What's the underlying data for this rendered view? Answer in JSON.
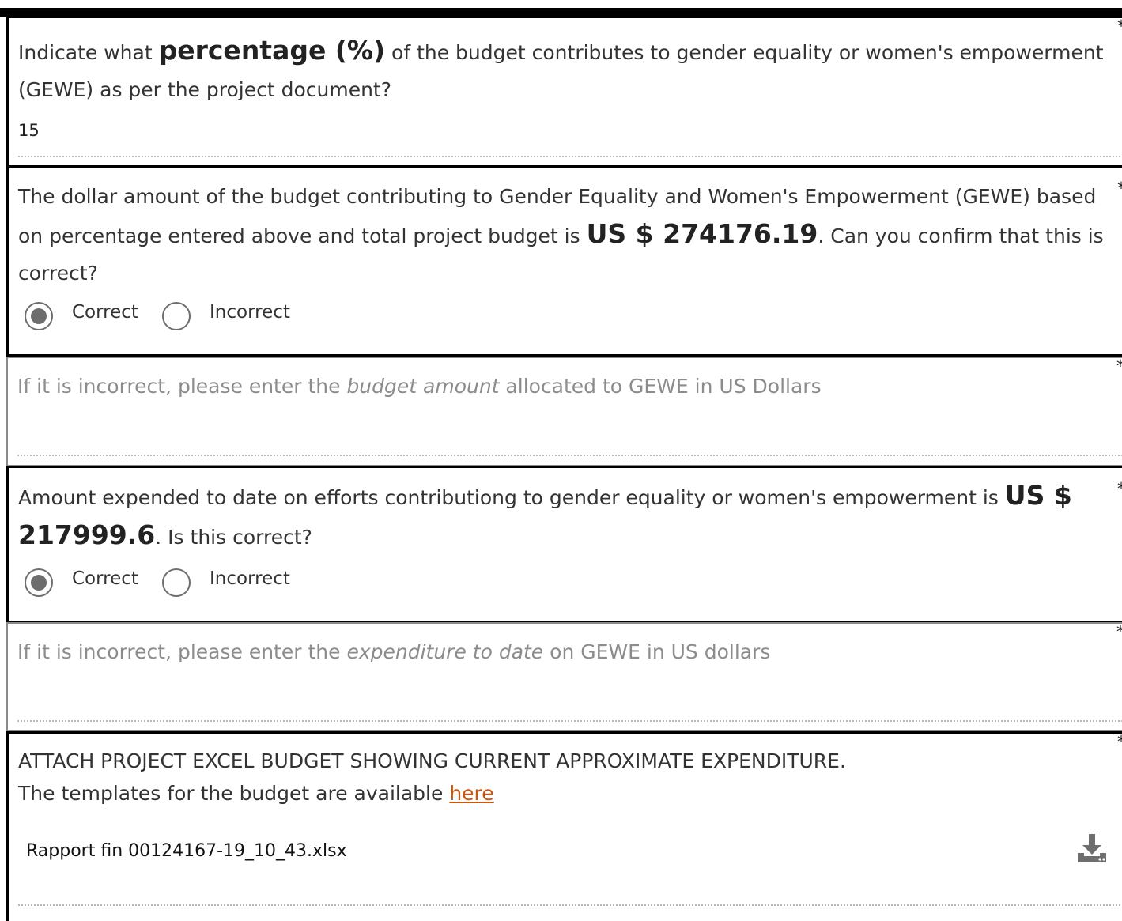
{
  "q1": {
    "text_a": "Indicate what ",
    "text_bold": "percentage (%)",
    "text_b": " of the budget contributes to gender equality or women's empowerment (GEWE) as per the project document?",
    "value": "15",
    "required": "*"
  },
  "q2": {
    "text_a": "The dollar amount of the budget contributing to Gender Equality and Women's Empowerment (GEWE) based on percentage entered above and total project budget is ",
    "text_bold": "US $ 274176.19",
    "text_b": ". Can you confirm that this is correct?",
    "options": [
      "Correct",
      "Incorrect"
    ],
    "selected": "Correct",
    "required": "*"
  },
  "q3": {
    "text_a": "If it is incorrect, please enter the ",
    "text_italic": "budget amount",
    "text_b": " allocated to GEWE in US Dollars",
    "value": "",
    "required": "*"
  },
  "q4": {
    "text_a": "Amount expended to date on efforts contributiong to gender equality or women's empowerment is ",
    "text_bold": "US $ 217999.6",
    "text_b": ". Is this correct?",
    "options": [
      "Correct",
      "Incorrect"
    ],
    "selected": "Correct",
    "required": "*"
  },
  "q5": {
    "text_a": "If it is incorrect, please enter the ",
    "text_italic": "expenditure to date",
    "text_b": " on GEWE in US dollars",
    "value": "",
    "required": "*"
  },
  "q6": {
    "title": "ATTACH PROJECT EXCEL BUDGET SHOWING CURRENT APPROXIMATE EXPENDITURE.",
    "templates_text": "The templates for the budget are available ",
    "link_text": "here",
    "file_name": "Rapport fin 00124167-19_10_43.xlsx",
    "download_icon": "download-icon",
    "required": "*"
  },
  "colors": {
    "link": "#c9570f",
    "radio_selected": "#6d6d6d",
    "muted_text": "#8c8c8c"
  }
}
